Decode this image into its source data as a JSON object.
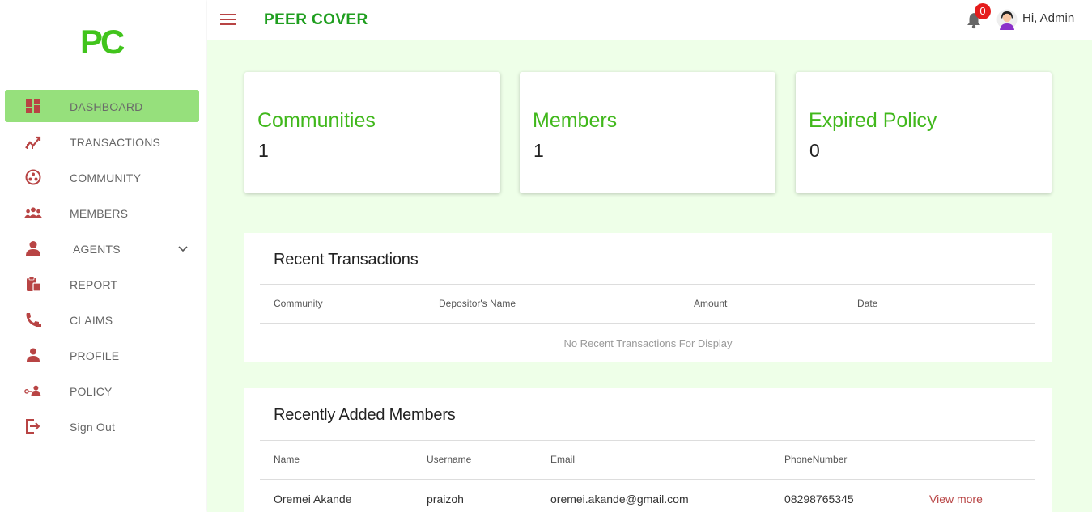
{
  "brand": {
    "logo": "PC",
    "title": "PEER COVER",
    "primary_color": "#41c41c",
    "sidebar_active_bg": "#96e07c",
    "icon_color": "#b84444"
  },
  "sidebar": {
    "items": [
      {
        "label": "DASHBOARD",
        "icon": "dashboard-icon",
        "active": true
      },
      {
        "label": "TRANSACTIONS",
        "icon": "transactions-chart-icon"
      },
      {
        "label": "COMMUNITY",
        "icon": "community-icon"
      },
      {
        "label": "MEMBERS",
        "icon": "members-icon"
      },
      {
        "label": "AGENTS",
        "icon": "agent-icon",
        "expandable": true
      },
      {
        "label": "REPORT",
        "icon": "report-icon"
      },
      {
        "label": "CLAIMS",
        "icon": "claims-phone-icon"
      },
      {
        "label": "PROFILE",
        "icon": "profile-icon"
      },
      {
        "label": "POLICY",
        "icon": "policy-key-icon"
      },
      {
        "label": "Sign Out",
        "icon": "sign-out-icon"
      }
    ]
  },
  "header": {
    "notifications_count": "0",
    "greeting": "Hi, Admin"
  },
  "stats": [
    {
      "title": "Communities",
      "value": "1"
    },
    {
      "title": "Members",
      "value": "1"
    },
    {
      "title": "Expired Policy",
      "value": "0"
    }
  ],
  "recent_transactions": {
    "title": "Recent Transactions",
    "columns": [
      "Community",
      "Depositor's Name",
      "Amount",
      "Date"
    ],
    "empty_text": "No Recent Transactions For Display"
  },
  "recent_members": {
    "title": "Recently Added Members",
    "columns": [
      "Name",
      "Username",
      "Email",
      "PhoneNumber"
    ],
    "rows": [
      {
        "name": "Oremei Akande",
        "username": "praizoh",
        "email": "oremei.akande@gmail.com",
        "phone": "08298765345",
        "action": "View more"
      }
    ]
  }
}
